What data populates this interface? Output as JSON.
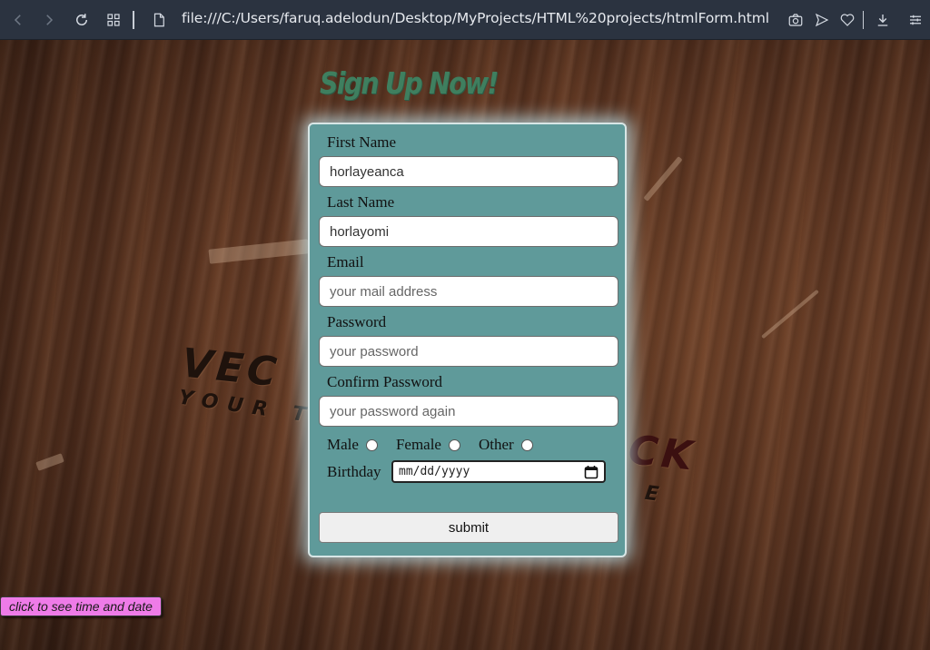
{
  "browser": {
    "url": "file:///C:/Users/faruq.adelodun/Desktop/MyProjects/HTML%20projects/htmlForm.html",
    "icons": [
      "back-icon",
      "forward-icon",
      "reload-icon",
      "grid-icon",
      "page-icon",
      "camera-icon",
      "send-icon",
      "heart-icon",
      "download-icon",
      "settings-icon"
    ]
  },
  "page": {
    "title": "Sign Up Now!",
    "background_logo_line1": "VEC",
    "background_logo_line2": "YOUR T",
    "background_logo_fragment": "CK",
    "background_logo_fragment2": "E"
  },
  "form": {
    "first_name_label": "First Name",
    "first_name_value": "horlayeanca",
    "last_name_label": "Last Name",
    "last_name_value": "horlayomi",
    "email_label": "Email",
    "email_placeholder": "your mail address",
    "password_label": "Password",
    "password_placeholder": "your password",
    "confirm_label": "Confirm Password",
    "confirm_placeholder": "your password again",
    "gender_options": [
      "Male",
      "Female",
      "Other"
    ],
    "birthday_label": "Birthday",
    "birthday_placeholder": "mm/dd/yyyy",
    "submit_label": "submit"
  },
  "time_button_label": "click to see time and date",
  "colors": {
    "form_bg": "#5f9a9a",
    "title": "#3f7f5f",
    "time_button": "#ee7be8",
    "toolbar": "#2b3340"
  }
}
